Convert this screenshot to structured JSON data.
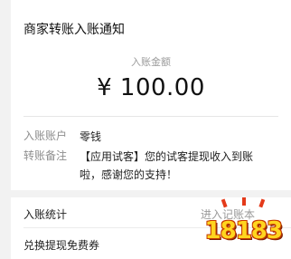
{
  "notice": {
    "title": "商家转账入账通知",
    "amount_label": "入账金额",
    "amount": "¥ 100.00"
  },
  "details": [
    {
      "key": "入账账户",
      "value": "零钱"
    },
    {
      "key": "转账备注",
      "value": "【应用试客】您的试客提现收入到账啦，感谢您的支持！"
    }
  ],
  "stats": {
    "label": "入账统计",
    "link": "进入记账本"
  },
  "voucher": {
    "label": "兑换提现免费券"
  },
  "watermark": {
    "text": "18183",
    "colors": {
      "fill": "#ffd51f",
      "outline": "#c63a00",
      "accent": "#e43a1a"
    }
  }
}
